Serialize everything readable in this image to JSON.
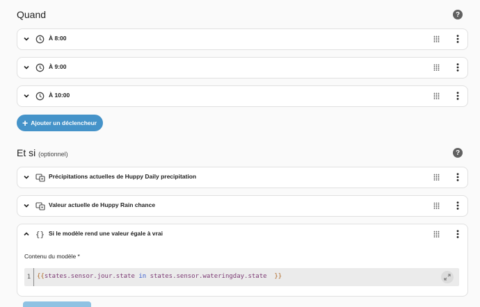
{
  "when": {
    "title": "Quand",
    "triggers": [
      {
        "label": "À 8:00"
      },
      {
        "label": "À 9:00"
      },
      {
        "label": "À 10:00"
      }
    ],
    "add_label": "Ajouter un déclencheur"
  },
  "conditions": {
    "title": "Et si",
    "subtitle": "(optionnel)",
    "items": [
      {
        "label": "Précipitations actuelles de Huppy Daily precipitation"
      },
      {
        "label": "Valeur actuelle de Huppy Rain chance"
      },
      {
        "label": "Si le modèle rend une valeur égale à vrai"
      }
    ],
    "template_field_label": "Contenu du modèle *",
    "editor": {
      "line_number": "1",
      "open_braces": "{{",
      "code_before": "states.sensor.jour.state ",
      "keyword": "in",
      "code_after": " states.sensor.wateringday.state  ",
      "close_braces": "}}"
    }
  },
  "help_glyph": "?",
  "colors": {
    "accent": "#4593c9",
    "help": "#616161",
    "template_purple": "#7c3a74",
    "brace_orange": "#b06a28",
    "keyword_blue": "#3b5fcf"
  }
}
